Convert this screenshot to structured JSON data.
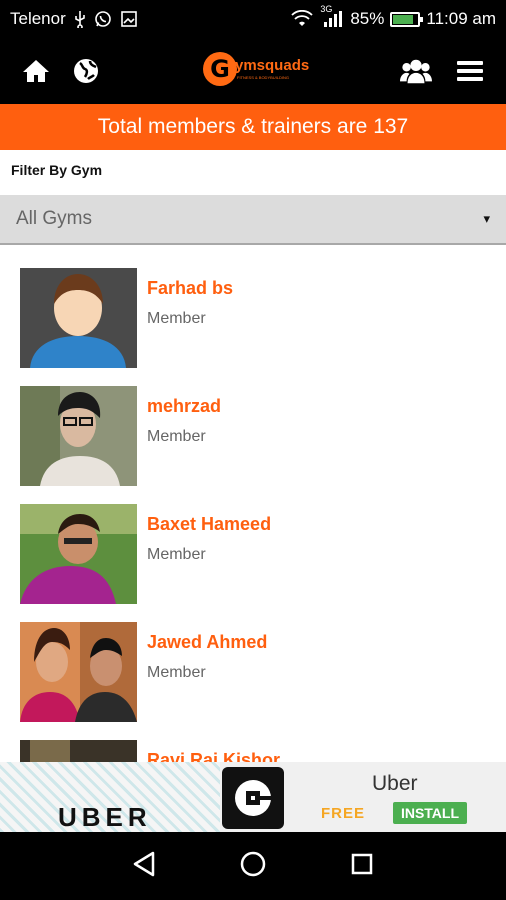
{
  "status_bar": {
    "carrier": "Telenor",
    "network": "3G",
    "battery": "85%",
    "battery_level": 0.85,
    "time": "11:09 am",
    "icons": [
      "usb-icon",
      "whatsapp-icon",
      "gallery-icon",
      "wifi-icon",
      "signal-icon",
      "battery-icon"
    ]
  },
  "header": {
    "logo_letter": "G",
    "logo_text": "ymsquads",
    "logo_tagline": "FITNESS & BODYBUILDING",
    "icons": [
      "home-icon",
      "globe-icon",
      "group-icon",
      "menu-icon"
    ]
  },
  "banner": {
    "text": "Total members & trainers are 137"
  },
  "filter": {
    "label": "Filter By Gym",
    "selected": "All Gyms",
    "caret": "▾"
  },
  "members": [
    {
      "name": "Farhad bs",
      "role": "Member"
    },
    {
      "name": "mehrzad",
      "role": "Member"
    },
    {
      "name": "Baxet Hameed",
      "role": "Member"
    },
    {
      "name": "Jawed Ahmed",
      "role": "Member"
    },
    {
      "name": "Ravi Raj Kishor",
      "role": ""
    }
  ],
  "ad": {
    "brand": "UBER",
    "title": "Uber",
    "price": "FREE",
    "install_label": "INSTALL"
  },
  "nav_bar": {
    "icons": [
      "back-icon",
      "home-circle-icon",
      "recents-icon"
    ]
  },
  "colors": {
    "accent": "#ff5f0f",
    "header_bg": "#000000",
    "install_green": "#4caf50"
  }
}
